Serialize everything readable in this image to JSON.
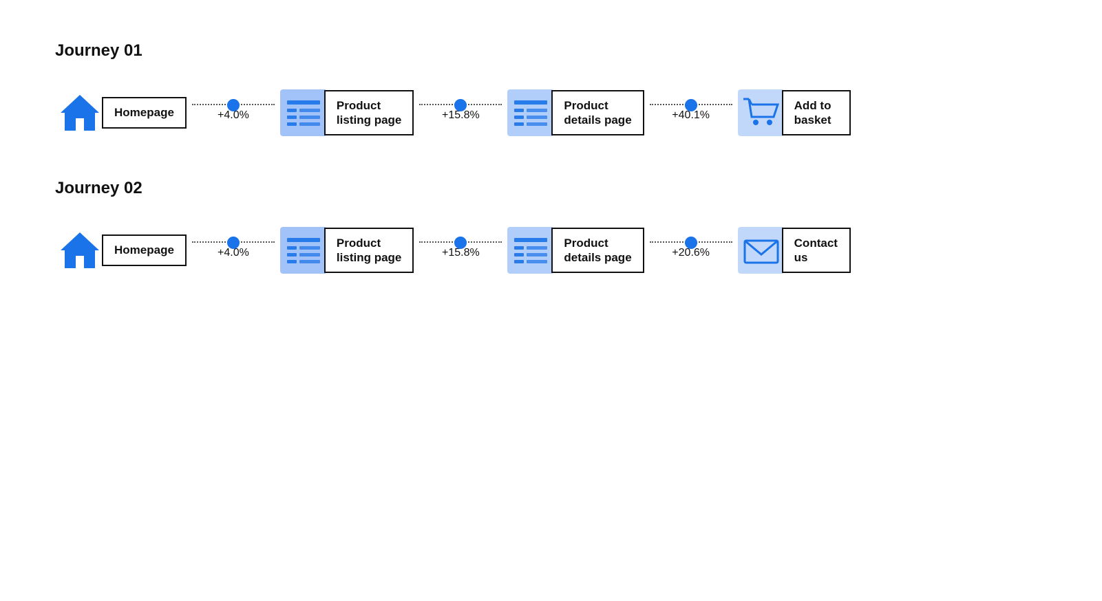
{
  "journeys": [
    {
      "id": "journey-01",
      "title": "Journey 01",
      "steps": [
        {
          "id": "homepage",
          "label": "Homepage",
          "icon": "home"
        },
        {
          "id": "product-listing-1",
          "label": "Product\nlisting page",
          "icon": "list"
        },
        {
          "id": "product-details-1",
          "label": "Product\ndetails page",
          "icon": "list"
        },
        {
          "id": "add-to-basket",
          "label": "Add to\nbasket",
          "icon": "cart"
        }
      ],
      "connectors": [
        {
          "percent": "+4.0%"
        },
        {
          "percent": "+15.8%"
        },
        {
          "percent": "+40.1%"
        }
      ]
    },
    {
      "id": "journey-02",
      "title": "Journey 02",
      "steps": [
        {
          "id": "homepage-2",
          "label": "Homepage",
          "icon": "home"
        },
        {
          "id": "product-listing-2",
          "label": "Product\nlisting page",
          "icon": "list"
        },
        {
          "id": "product-details-2",
          "label": "Product\ndetails page",
          "icon": "list"
        },
        {
          "id": "contact-us",
          "label": "Contact\nus",
          "icon": "envelope"
        }
      ],
      "connectors": [
        {
          "percent": "+4.0%"
        },
        {
          "percent": "+15.8%"
        },
        {
          "percent": "+20.6%"
        }
      ]
    }
  ]
}
